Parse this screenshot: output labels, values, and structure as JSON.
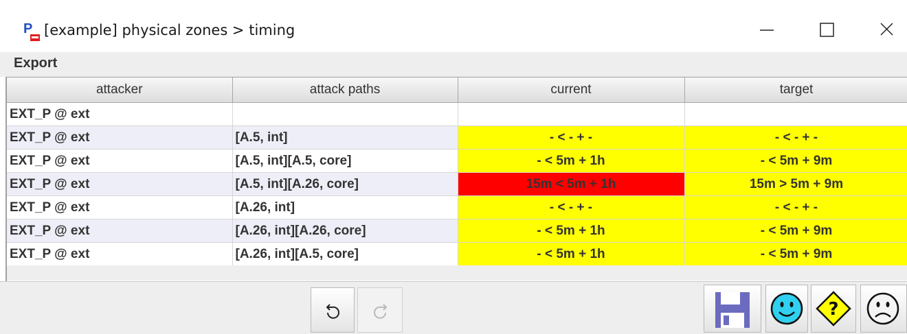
{
  "window": {
    "title": "[example] physical zones > timing",
    "minimize_glyph": "—",
    "maximize_glyph": "☐",
    "close_glyph": "✕"
  },
  "menu": {
    "export_label": "Export"
  },
  "table": {
    "columns": [
      "attacker",
      "attack paths",
      "current",
      "target"
    ],
    "rows": [
      {
        "attacker": "EXT_P @ ext",
        "path": "",
        "current": "",
        "target": ""
      },
      {
        "attacker": "EXT_P @ ext",
        "path": "[A.5, int]",
        "current": "- < - + -",
        "target": "- < - + -"
      },
      {
        "attacker": "EXT_P @ ext",
        "path": "[A.5, int][A.5, core]",
        "current": "- < 5m + 1h",
        "target": "- < 5m + 9m"
      },
      {
        "attacker": "EXT_P @ ext",
        "path": "[A.5, int][A.26, core]",
        "current": "15m < 5m + 1h",
        "target": "15m > 5m + 9m"
      },
      {
        "attacker": "EXT_P @ ext",
        "path": "[A.26, int]",
        "current": "- < - + -",
        "target": "- < - + -"
      },
      {
        "attacker": "EXT_P @ ext",
        "path": "[A.26, int][A.26, core]",
        "current": "- < 5m + 1h",
        "target": "- < 5m + 9m"
      },
      {
        "attacker": "EXT_P @ ext",
        "path": "[A.26, int][A.5, core]",
        "current": "- < 5m + 1h",
        "target": "- < 5m + 9m"
      }
    ]
  },
  "colors": {
    "highlight_yellow": "#ffff00",
    "alert_red": "#ff0000",
    "row_tint": "#eeeef8",
    "smiley": "#30d0f0",
    "save_icon": "#6b6bbf"
  },
  "toolbar": {
    "undo_icon": "undo-icon",
    "redo_icon": "redo-icon",
    "save_icon": "save-icon",
    "happy_icon": "happy-face-icon",
    "question_icon": "question-diamond-icon",
    "sad_icon": "sad-face-icon"
  }
}
